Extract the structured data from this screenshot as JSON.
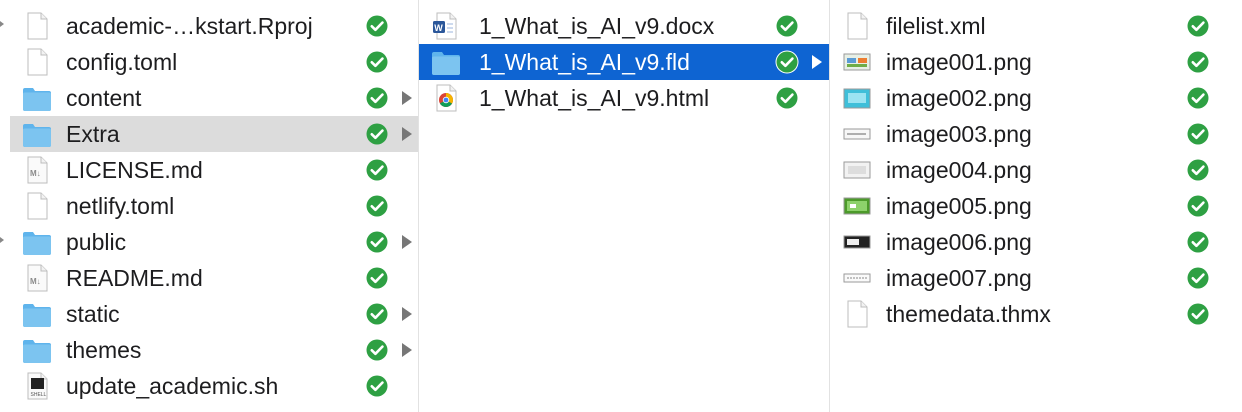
{
  "columns": [
    {
      "items": [
        {
          "name": "academic-…kstart.Rproj",
          "type": "file",
          "icon": "blank-document-icon",
          "status": "synced",
          "folder": false
        },
        {
          "name": "config.toml",
          "type": "file",
          "icon": "blank-document-icon",
          "status": "synced",
          "folder": false
        },
        {
          "name": "content",
          "type": "folder",
          "icon": "folder-icon",
          "status": "synced",
          "folder": true
        },
        {
          "name": "Extra",
          "type": "folder",
          "icon": "folder-icon",
          "status": "synced",
          "folder": true,
          "selected": "inactive"
        },
        {
          "name": "LICENSE.md",
          "type": "markdown",
          "icon": "markdown-document-icon",
          "status": "synced",
          "folder": false
        },
        {
          "name": "netlify.toml",
          "type": "file",
          "icon": "blank-document-icon",
          "status": "synced",
          "folder": false
        },
        {
          "name": "public",
          "type": "folder",
          "icon": "folder-icon",
          "status": "synced",
          "folder": true
        },
        {
          "name": "README.md",
          "type": "markdown",
          "icon": "markdown-document-icon",
          "status": "synced",
          "folder": false
        },
        {
          "name": "static",
          "type": "folder",
          "icon": "folder-icon",
          "status": "synced",
          "folder": true
        },
        {
          "name": "themes",
          "type": "folder",
          "icon": "folder-icon",
          "status": "synced",
          "folder": true
        },
        {
          "name": "update_academic.sh",
          "type": "shell",
          "icon": "shell-script-icon",
          "status": "synced",
          "folder": false
        }
      ]
    },
    {
      "items": [
        {
          "name": "1_What_is_AI_v9.docx",
          "type": "word",
          "icon": "word-document-icon",
          "status": "synced",
          "folder": false
        },
        {
          "name": "1_What_is_AI_v9.fld",
          "type": "folder",
          "icon": "folder-icon",
          "status": "synced",
          "folder": true,
          "selected": "active"
        },
        {
          "name": "1_What_is_AI_v9.html",
          "type": "html",
          "icon": "chrome-html-icon",
          "status": "synced",
          "folder": false
        }
      ]
    },
    {
      "items": [
        {
          "name": "filelist.xml",
          "type": "file",
          "icon": "blank-document-icon",
          "status": "synced",
          "folder": false
        },
        {
          "name": "image001.png",
          "type": "image",
          "icon": "image-thumbnail-icon",
          "thumb": "a",
          "status": "synced",
          "folder": false
        },
        {
          "name": "image002.png",
          "type": "image",
          "icon": "image-thumbnail-icon",
          "thumb": "b",
          "status": "synced",
          "folder": false
        },
        {
          "name": "image003.png",
          "type": "image",
          "icon": "image-thumbnail-icon",
          "thumb": "c",
          "status": "synced",
          "folder": false
        },
        {
          "name": "image004.png",
          "type": "image",
          "icon": "image-thumbnail-icon",
          "thumb": "d",
          "status": "synced",
          "folder": false
        },
        {
          "name": "image005.png",
          "type": "image",
          "icon": "image-thumbnail-icon",
          "thumb": "e",
          "status": "synced",
          "folder": false
        },
        {
          "name": "image006.png",
          "type": "image",
          "icon": "image-thumbnail-icon",
          "thumb": "f",
          "status": "synced",
          "folder": false
        },
        {
          "name": "image007.png",
          "type": "image",
          "icon": "image-thumbnail-icon",
          "thumb": "g",
          "status": "synced",
          "folder": false
        },
        {
          "name": "themedata.thmx",
          "type": "file",
          "icon": "blank-document-icon",
          "status": "synced",
          "folder": false
        }
      ]
    }
  ],
  "colors": {
    "selection_active": "#0e64d2",
    "selection_inactive": "#dcdcdc",
    "sync_check": "#2ea043",
    "folder": "#7cc4f0"
  }
}
